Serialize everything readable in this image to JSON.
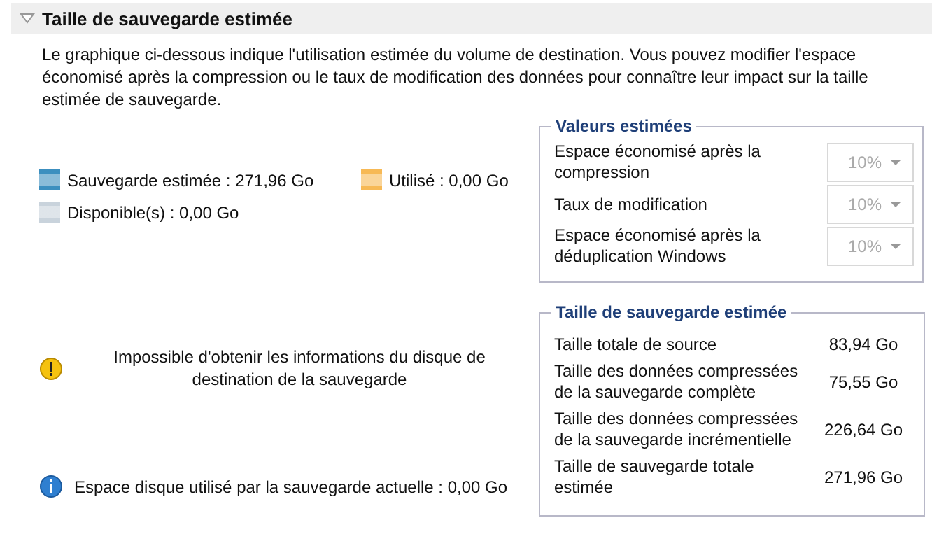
{
  "section": {
    "title": "Taille de sauvegarde estimée",
    "expanded": true
  },
  "description": "Le graphique ci-dessous indique l'utilisation estimée du volume de destination. Vous pouvez modifier l'espace économisé après la compression ou le taux de modification des données pour connaître leur impact sur la taille estimée de sauvegarde.",
  "legend": [
    {
      "label": "Sauvegarde estimée : 271,96 Go",
      "color": "#3c8fbf"
    },
    {
      "label": "Utilisé : 0,00 Go",
      "color": "#f7b955"
    },
    {
      "label": "Disponible(s) : 0,00 Go",
      "color": "#c9d3dc"
    }
  ],
  "messages": [
    {
      "kind": "warning",
      "text": "Impossible d'obtenir les informations du disque de destination de la sauvegarde"
    },
    {
      "kind": "info",
      "text": "Espace disque utilisé par la sauvegarde actuelle : 0,00 Go"
    }
  ],
  "estimated_values": {
    "title": "Valeurs estimées",
    "rows": [
      {
        "label": "Espace économisé après la compression",
        "value": "10%",
        "disabled": true
      },
      {
        "label": "Taux de modification",
        "value": "10%",
        "disabled": true
      },
      {
        "label": "Espace économisé après la déduplication Windows",
        "value": "10%",
        "disabled": true
      }
    ]
  },
  "estimated_size": {
    "title": "Taille de sauvegarde estimée",
    "rows": [
      {
        "label": "Taille totale de source",
        "value": "83,94 Go"
      },
      {
        "label": "Taille des données compressées de la sauvegarde complète",
        "value": "75,55 Go"
      },
      {
        "label": "Taille des données compressées de la sauvegarde incrémentielle",
        "value": "226,64 Go"
      },
      {
        "label": "Taille de sauvegarde totale estimée",
        "value": "271,96 Go"
      }
    ]
  }
}
